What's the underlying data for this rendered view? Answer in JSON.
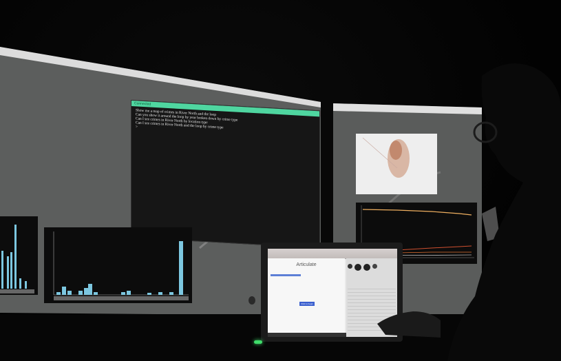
{
  "terminal": {
    "status": "Connected",
    "lines": [
      "Show me a map of crimes in River North and the loop",
      "Can you show it around the loop by year broken down by crime type",
      "Can I see crimes in River North by location type",
      "Can I see crimes in River North and the loop by crime type",
      ">"
    ]
  },
  "laptop": {
    "app_title": "Articulate",
    "button_label": "Click to begin"
  },
  "colors": {
    "terminal_bar": "#4fd6a0",
    "bar_fill": "#7cc7e0",
    "line_orange": "#f0b060",
    "line_red": "#d05030",
    "laptop_button": "#3a5fcf"
  },
  "icons": {
    "apple_logo": "apple-logo-icon",
    "power_led": "power-led-icon"
  }
}
